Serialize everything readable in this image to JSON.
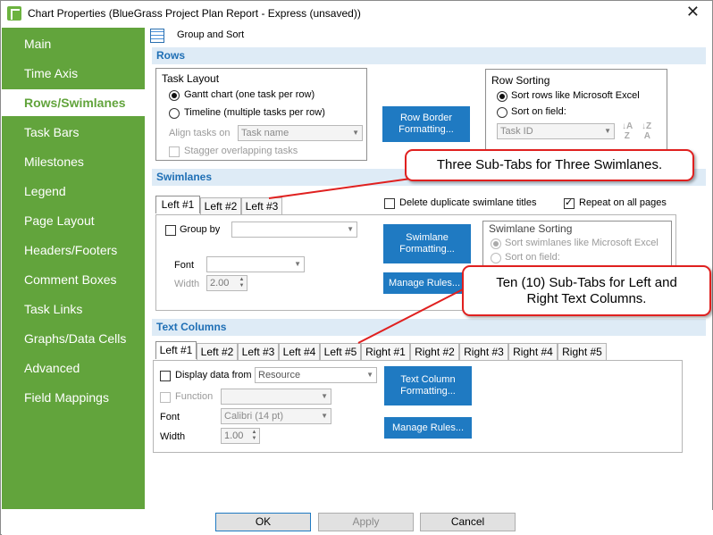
{
  "window": {
    "title": "Chart Properties (BlueGrass Project Plan Report - Express (unsaved))",
    "close_glyph": "✕"
  },
  "sidebar": {
    "items": [
      {
        "label": "Main"
      },
      {
        "label": "Time Axis"
      },
      {
        "label": "Rows/Swimlanes",
        "active": true
      },
      {
        "label": "Task Bars"
      },
      {
        "label": "Milestones"
      },
      {
        "label": "Legend"
      },
      {
        "label": "Page Layout"
      },
      {
        "label": "Headers/Footers"
      },
      {
        "label": "Comment Boxes"
      },
      {
        "label": "Task Links"
      },
      {
        "label": "Graphs/Data Cells"
      },
      {
        "label": "Advanced"
      },
      {
        "label": "Field Mappings"
      }
    ],
    "color": "#62a43c"
  },
  "breadcrumb": {
    "label": "Group and Sort",
    "icon": "grid-icon"
  },
  "rows": {
    "header": "Rows",
    "task_layout": {
      "title": "Task Layout",
      "option_gantt": "Gantt chart (one task per row)",
      "option_timeline": "Timeline (multiple tasks per row)",
      "align_label": "Align tasks on",
      "align_value": "Task name",
      "stagger_label": "Stagger overlapping tasks"
    },
    "row_border_button": "Row Border Formatting...",
    "row_sorting": {
      "title": "Row Sorting",
      "option_excel": "Sort rows like Microsoft Excel",
      "option_field": "Sort on field:",
      "field_value": "Task ID"
    }
  },
  "swimlanes": {
    "header": "Swimlanes",
    "tabs": [
      "Left #1",
      "Left #2",
      "Left #3"
    ],
    "delete_dup_label": "Delete duplicate swimlane titles",
    "repeat_label": "Repeat on all pages",
    "group_by_label": "Group by",
    "group_by_value": "",
    "font_label": "Font",
    "font_value": "",
    "width_label": "Width",
    "width_value": "2.00",
    "formatting_button": "Swimlane Formatting...",
    "manage_rules_button": "Manage Rules...",
    "sorting": {
      "title": "Swimlane Sorting",
      "option_excel": "Sort swimlanes like Microsoft Excel",
      "option_field": "Sort on field:"
    }
  },
  "text_columns": {
    "header": "Text Columns",
    "tabs": [
      "Left #1",
      "Left #2",
      "Left #3",
      "Left #4",
      "Left #5",
      "Right #1",
      "Right #2",
      "Right #3",
      "Right #4",
      "Right #5"
    ],
    "display_from_label": "Display data from",
    "display_from_value": "Resource",
    "function_label": "Function",
    "function_value": "",
    "font_label": "Font",
    "font_value": "Calibri (14 pt)",
    "width_label": "Width",
    "width_value": "1.00",
    "formatting_button": "Text Column Formatting...",
    "manage_rules_button": "Manage Rules..."
  },
  "callouts": {
    "swimlanes": "Three Sub-Tabs for Three Swimlanes.",
    "text_columns_line1": "Ten (10) Sub-Tabs for Left and",
    "text_columns_line2": "Right Text Columns."
  },
  "footer": {
    "ok": "OK",
    "apply": "Apply",
    "cancel": "Cancel"
  },
  "colors": {
    "accent_blue": "#1f7ac2",
    "section_bg": "#deebf6",
    "callout_border": "#e0201f"
  }
}
